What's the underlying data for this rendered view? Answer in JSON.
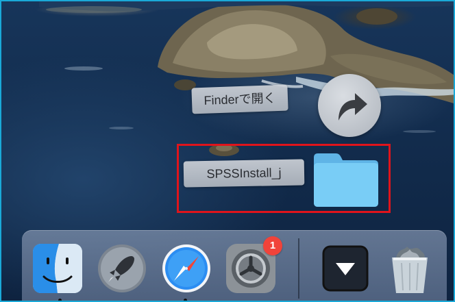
{
  "finder_stack": {
    "open_in_finder_label": "Finderで開く",
    "folder_label": "SPSSInstall_j"
  },
  "dock": {
    "items": [
      {
        "name": "Finder",
        "icon": "finder-icon"
      },
      {
        "name": "Launchpad",
        "icon": "rocket-icon"
      },
      {
        "name": "Safari",
        "icon": "compass-icon"
      },
      {
        "name": "System Preferences",
        "icon": "gear-icon",
        "badge": "1"
      },
      {
        "name": "Downloads stack",
        "icon": "arrow-down-icon"
      },
      {
        "name": "Trash",
        "icon": "trash-icon"
      }
    ]
  },
  "colors": {
    "highlight": "#e0141b",
    "frame": "#1aa9d8",
    "folder": "#6fc3f0",
    "badge": "#f1433a"
  }
}
